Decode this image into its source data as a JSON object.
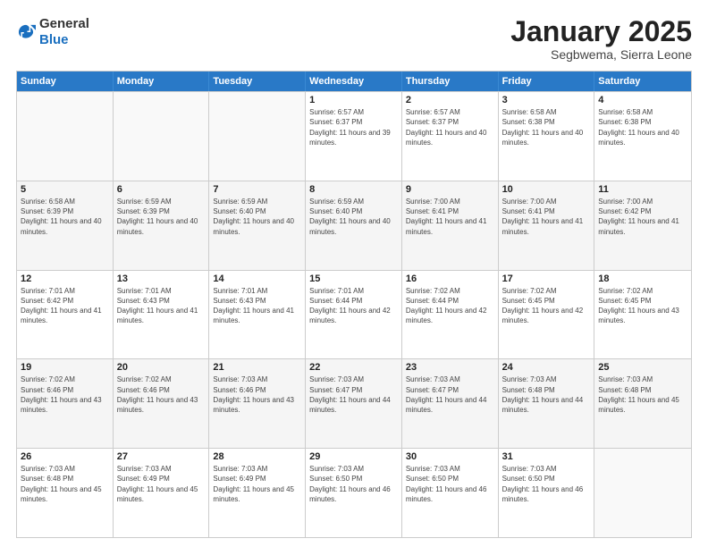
{
  "logo": {
    "general": "General",
    "blue": "Blue"
  },
  "title": {
    "month_year": "January 2025",
    "location": "Segbwema, Sierra Leone"
  },
  "weekdays": [
    "Sunday",
    "Monday",
    "Tuesday",
    "Wednesday",
    "Thursday",
    "Friday",
    "Saturday"
  ],
  "rows": [
    [
      {
        "date": "",
        "sunrise": "",
        "sunset": "",
        "daylight": ""
      },
      {
        "date": "",
        "sunrise": "",
        "sunset": "",
        "daylight": ""
      },
      {
        "date": "",
        "sunrise": "",
        "sunset": "",
        "daylight": ""
      },
      {
        "date": "1",
        "sunrise": "Sunrise: 6:57 AM",
        "sunset": "Sunset: 6:37 PM",
        "daylight": "Daylight: 11 hours and 39 minutes."
      },
      {
        "date": "2",
        "sunrise": "Sunrise: 6:57 AM",
        "sunset": "Sunset: 6:37 PM",
        "daylight": "Daylight: 11 hours and 40 minutes."
      },
      {
        "date": "3",
        "sunrise": "Sunrise: 6:58 AM",
        "sunset": "Sunset: 6:38 PM",
        "daylight": "Daylight: 11 hours and 40 minutes."
      },
      {
        "date": "4",
        "sunrise": "Sunrise: 6:58 AM",
        "sunset": "Sunset: 6:38 PM",
        "daylight": "Daylight: 11 hours and 40 minutes."
      }
    ],
    [
      {
        "date": "5",
        "sunrise": "Sunrise: 6:58 AM",
        "sunset": "Sunset: 6:39 PM",
        "daylight": "Daylight: 11 hours and 40 minutes."
      },
      {
        "date": "6",
        "sunrise": "Sunrise: 6:59 AM",
        "sunset": "Sunset: 6:39 PM",
        "daylight": "Daylight: 11 hours and 40 minutes."
      },
      {
        "date": "7",
        "sunrise": "Sunrise: 6:59 AM",
        "sunset": "Sunset: 6:40 PM",
        "daylight": "Daylight: 11 hours and 40 minutes."
      },
      {
        "date": "8",
        "sunrise": "Sunrise: 6:59 AM",
        "sunset": "Sunset: 6:40 PM",
        "daylight": "Daylight: 11 hours and 40 minutes."
      },
      {
        "date": "9",
        "sunrise": "Sunrise: 7:00 AM",
        "sunset": "Sunset: 6:41 PM",
        "daylight": "Daylight: 11 hours and 41 minutes."
      },
      {
        "date": "10",
        "sunrise": "Sunrise: 7:00 AM",
        "sunset": "Sunset: 6:41 PM",
        "daylight": "Daylight: 11 hours and 41 minutes."
      },
      {
        "date": "11",
        "sunrise": "Sunrise: 7:00 AM",
        "sunset": "Sunset: 6:42 PM",
        "daylight": "Daylight: 11 hours and 41 minutes."
      }
    ],
    [
      {
        "date": "12",
        "sunrise": "Sunrise: 7:01 AM",
        "sunset": "Sunset: 6:42 PM",
        "daylight": "Daylight: 11 hours and 41 minutes."
      },
      {
        "date": "13",
        "sunrise": "Sunrise: 7:01 AM",
        "sunset": "Sunset: 6:43 PM",
        "daylight": "Daylight: 11 hours and 41 minutes."
      },
      {
        "date": "14",
        "sunrise": "Sunrise: 7:01 AM",
        "sunset": "Sunset: 6:43 PM",
        "daylight": "Daylight: 11 hours and 41 minutes."
      },
      {
        "date": "15",
        "sunrise": "Sunrise: 7:01 AM",
        "sunset": "Sunset: 6:44 PM",
        "daylight": "Daylight: 11 hours and 42 minutes."
      },
      {
        "date": "16",
        "sunrise": "Sunrise: 7:02 AM",
        "sunset": "Sunset: 6:44 PM",
        "daylight": "Daylight: 11 hours and 42 minutes."
      },
      {
        "date": "17",
        "sunrise": "Sunrise: 7:02 AM",
        "sunset": "Sunset: 6:45 PM",
        "daylight": "Daylight: 11 hours and 42 minutes."
      },
      {
        "date": "18",
        "sunrise": "Sunrise: 7:02 AM",
        "sunset": "Sunset: 6:45 PM",
        "daylight": "Daylight: 11 hours and 43 minutes."
      }
    ],
    [
      {
        "date": "19",
        "sunrise": "Sunrise: 7:02 AM",
        "sunset": "Sunset: 6:46 PM",
        "daylight": "Daylight: 11 hours and 43 minutes."
      },
      {
        "date": "20",
        "sunrise": "Sunrise: 7:02 AM",
        "sunset": "Sunset: 6:46 PM",
        "daylight": "Daylight: 11 hours and 43 minutes."
      },
      {
        "date": "21",
        "sunrise": "Sunrise: 7:03 AM",
        "sunset": "Sunset: 6:46 PM",
        "daylight": "Daylight: 11 hours and 43 minutes."
      },
      {
        "date": "22",
        "sunrise": "Sunrise: 7:03 AM",
        "sunset": "Sunset: 6:47 PM",
        "daylight": "Daylight: 11 hours and 44 minutes."
      },
      {
        "date": "23",
        "sunrise": "Sunrise: 7:03 AM",
        "sunset": "Sunset: 6:47 PM",
        "daylight": "Daylight: 11 hours and 44 minutes."
      },
      {
        "date": "24",
        "sunrise": "Sunrise: 7:03 AM",
        "sunset": "Sunset: 6:48 PM",
        "daylight": "Daylight: 11 hours and 44 minutes."
      },
      {
        "date": "25",
        "sunrise": "Sunrise: 7:03 AM",
        "sunset": "Sunset: 6:48 PM",
        "daylight": "Daylight: 11 hours and 45 minutes."
      }
    ],
    [
      {
        "date": "26",
        "sunrise": "Sunrise: 7:03 AM",
        "sunset": "Sunset: 6:48 PM",
        "daylight": "Daylight: 11 hours and 45 minutes."
      },
      {
        "date": "27",
        "sunrise": "Sunrise: 7:03 AM",
        "sunset": "Sunset: 6:49 PM",
        "daylight": "Daylight: 11 hours and 45 minutes."
      },
      {
        "date": "28",
        "sunrise": "Sunrise: 7:03 AM",
        "sunset": "Sunset: 6:49 PM",
        "daylight": "Daylight: 11 hours and 45 minutes."
      },
      {
        "date": "29",
        "sunrise": "Sunrise: 7:03 AM",
        "sunset": "Sunset: 6:50 PM",
        "daylight": "Daylight: 11 hours and 46 minutes."
      },
      {
        "date": "30",
        "sunrise": "Sunrise: 7:03 AM",
        "sunset": "Sunset: 6:50 PM",
        "daylight": "Daylight: 11 hours and 46 minutes."
      },
      {
        "date": "31",
        "sunrise": "Sunrise: 7:03 AM",
        "sunset": "Sunset: 6:50 PM",
        "daylight": "Daylight: 11 hours and 46 minutes."
      },
      {
        "date": "",
        "sunrise": "",
        "sunset": "",
        "daylight": ""
      }
    ]
  ]
}
